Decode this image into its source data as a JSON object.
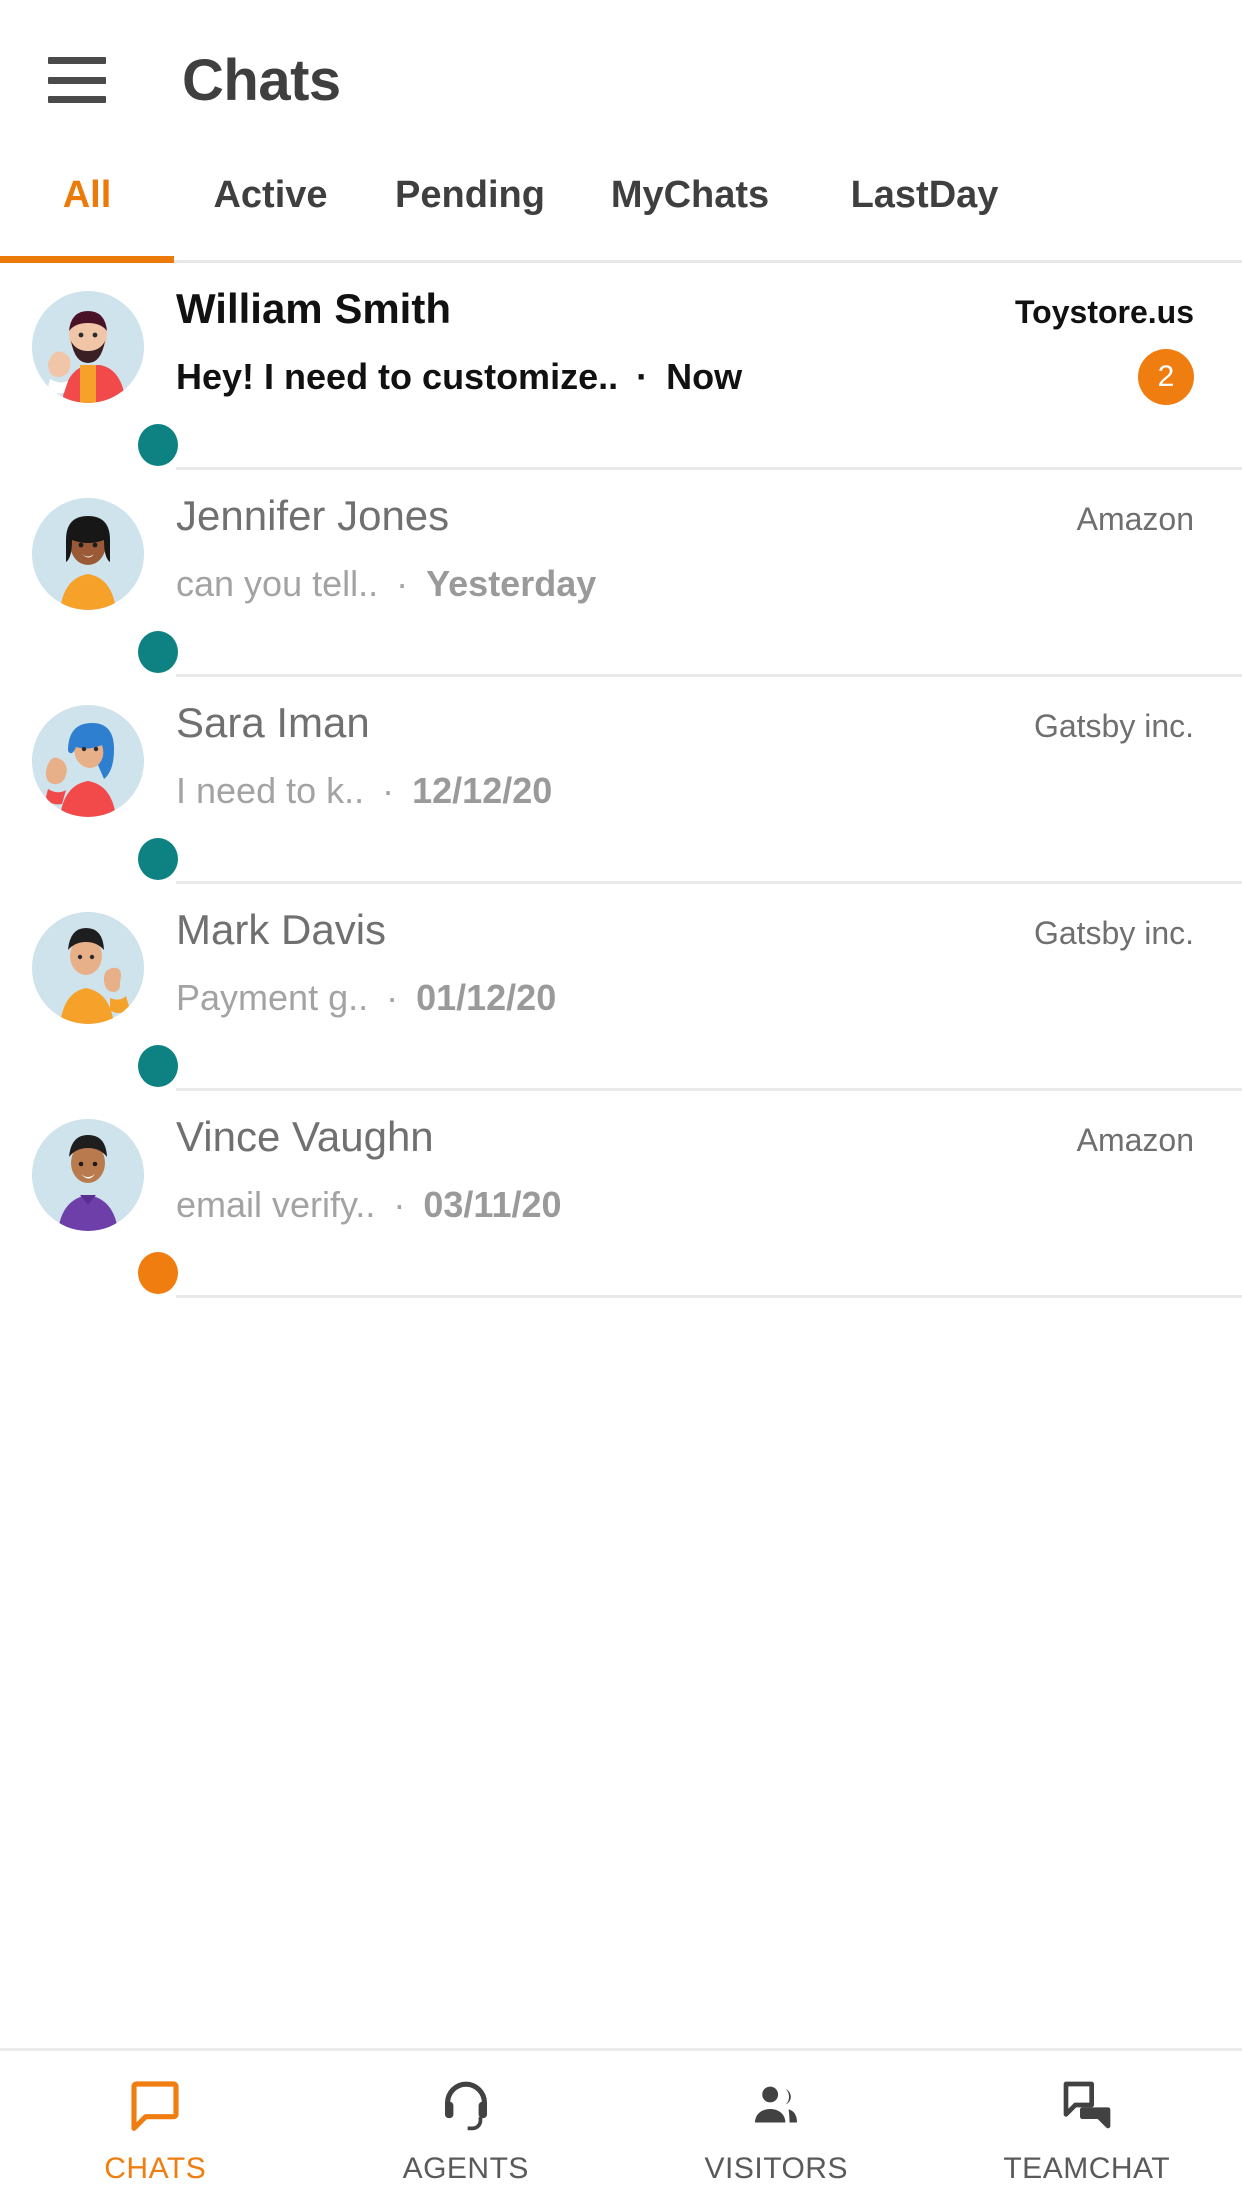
{
  "header": {
    "menu_icon": "hamburger-menu-icon",
    "title": "Chats"
  },
  "tabs": {
    "items": [
      {
        "label": "All",
        "selected": true
      },
      {
        "label": "Active",
        "selected": false
      },
      {
        "label": "Pending",
        "selected": false
      },
      {
        "label": "MyChats",
        "selected": false
      },
      {
        "label": "LastDay",
        "selected": false
      }
    ],
    "accent_color": "#ec7a08"
  },
  "chats": {
    "separator": "·",
    "rows": [
      {
        "name": "William Smith",
        "preview": "Hey! I need to customize..",
        "time": "Now",
        "company": "Toystore.us",
        "badge": "2",
        "unread": true,
        "status": "online"
      },
      {
        "name": "Jennifer Jones",
        "preview": "can you tell..",
        "time": "Yesterday",
        "company": "Amazon",
        "badge": "",
        "unread": false,
        "status": "online"
      },
      {
        "name": "Sara Iman",
        "preview": "I need to k..",
        "time": "12/12/20",
        "company": "Gatsby inc.",
        "badge": "",
        "unread": false,
        "status": "online"
      },
      {
        "name": "Mark Davis",
        "preview": "Payment g..",
        "time": "01/12/20",
        "company": "Gatsby inc.",
        "badge": "",
        "unread": false,
        "status": "online"
      },
      {
        "name": "Vince Vaughn",
        "preview": "email verify..",
        "time": "03/11/20",
        "company": "Amazon",
        "badge": "",
        "unread": false,
        "status": "away"
      }
    ]
  },
  "bottom_nav": {
    "items": [
      {
        "label": "CHATS",
        "icon": "chat-bubble-icon",
        "active": true
      },
      {
        "label": "AGENTS",
        "icon": "headset-icon",
        "active": false
      },
      {
        "label": "VISITORS",
        "icon": "people-icon",
        "active": false
      },
      {
        "label": "TEAMCHAT",
        "icon": "team-chat-icon",
        "active": false
      }
    ],
    "active_color": "#ef7d10",
    "inactive_color": "#5a5a5a"
  }
}
